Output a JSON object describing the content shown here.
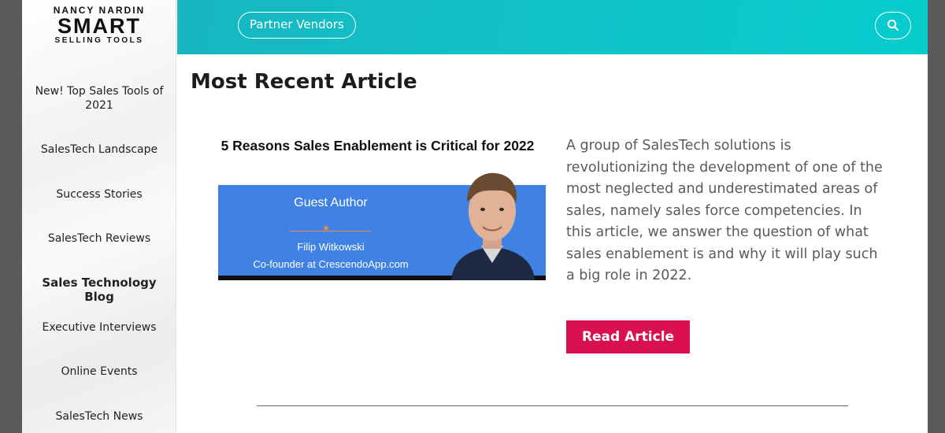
{
  "logo": {
    "line1": "NANCY NARDIN",
    "line2": "SMART",
    "line3": "SELLING TOOLS"
  },
  "sidebar": {
    "items": [
      {
        "label": "New! Top Sales Tools of 2021"
      },
      {
        "label": "SalesTech Landscape"
      },
      {
        "label": "Success Stories"
      },
      {
        "label": "SalesTech Reviews"
      },
      {
        "label": "Sales Technology Blog",
        "active": true
      },
      {
        "label": "Executive Interviews"
      },
      {
        "label": "Online Events"
      },
      {
        "label": "SalesTech News"
      }
    ]
  },
  "header": {
    "partner_label": "Partner Vendors",
    "search_icon": "search-icon"
  },
  "main": {
    "heading": "Most Recent Article",
    "article_image": {
      "title": "5 Reasons Sales Enablement is Critical for 2022",
      "badge": "Guest Author",
      "author": "Filip Witkowski",
      "role": "Co-founder at CrescendoApp.com"
    },
    "description": "A group of SalesTech solutions is revolutionizing the development of one of the most neglected and underestimated areas of sales, namely sales force competencies. In this article, we answer the question of what sales enablement is and why it will play such a big role in 2022.",
    "cta_label": "Read Article"
  },
  "colors": {
    "header_teal": "#11c3c9",
    "cta": "#d9114f",
    "banner_blue": "#3f82e4"
  }
}
